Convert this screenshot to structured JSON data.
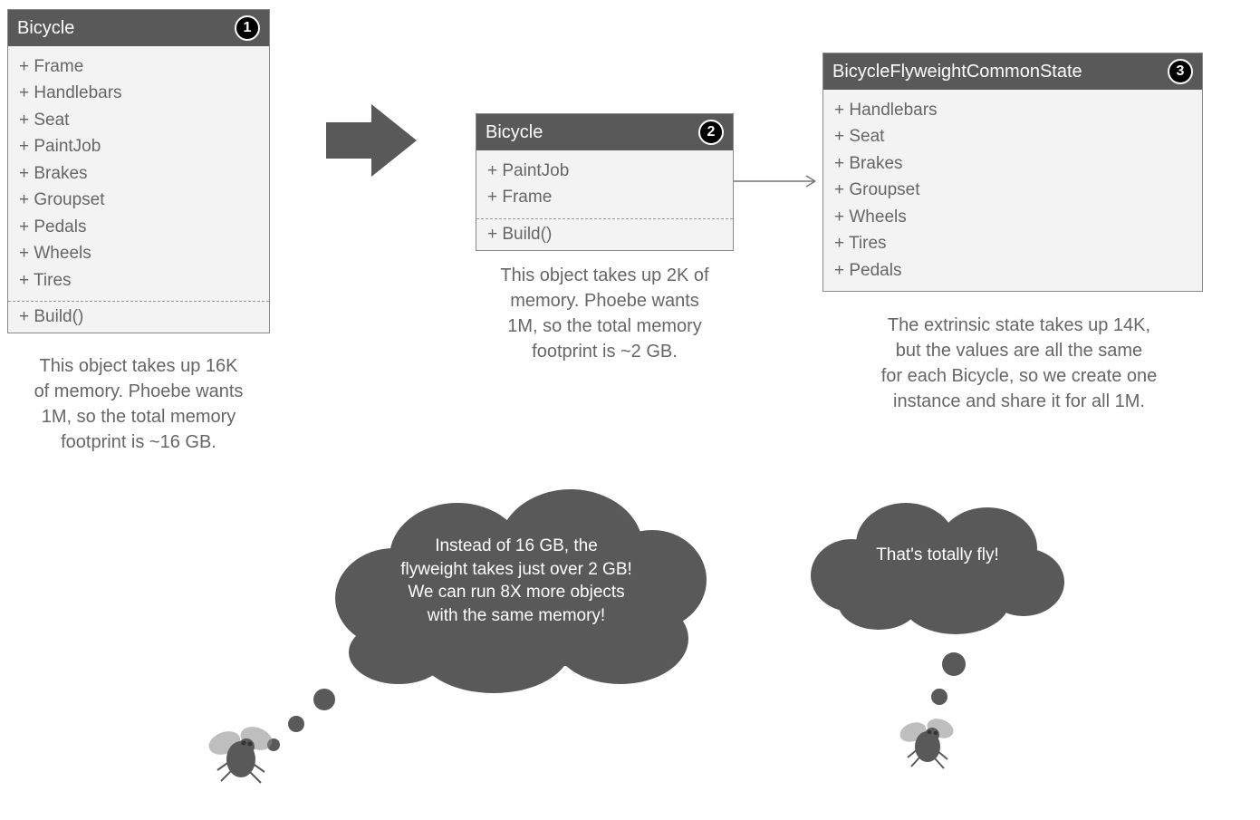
{
  "box1": {
    "title": "Bicycle",
    "badge": "1",
    "fields": [
      "+ Frame",
      "+ Handlebars",
      "+ Seat",
      "+ PaintJob",
      "+ Brakes",
      "+ Groupset",
      "+ Pedals",
      "+ Wheels",
      "+ Tires"
    ],
    "method": "+ Build()",
    "caption": "This object takes up 16K\nof memory.  Phoebe wants\n1M, so the total memory\nfootprint is ~16 GB."
  },
  "box2": {
    "title": "Bicycle",
    "badge": "2",
    "fields": [
      "+ PaintJob",
      "+ Frame"
    ],
    "method": "+ Build()",
    "caption": "This object takes up 2K of\nmemory.  Phoebe wants\n1M, so the total memory\nfootprint is ~2 GB."
  },
  "box3": {
    "title": "BicycleFlyweightCommonState",
    "badge": "3",
    "fields": [
      "+ Handlebars",
      "+ Seat",
      "+ Brakes",
      "+ Groupset",
      "+ Wheels",
      "+ Tires",
      "+ Pedals"
    ],
    "caption": "The extrinsic state takes up 14K,\nbut the values are all the same\nfor each Bicycle, so we create one\ninstance and share it for all 1M."
  },
  "thought1": "Instead of 16 GB, the\nflyweight takes just over 2 GB!\nWe can run 8X more objects\nwith the same memory!",
  "thought2": "That's totally fly!"
}
